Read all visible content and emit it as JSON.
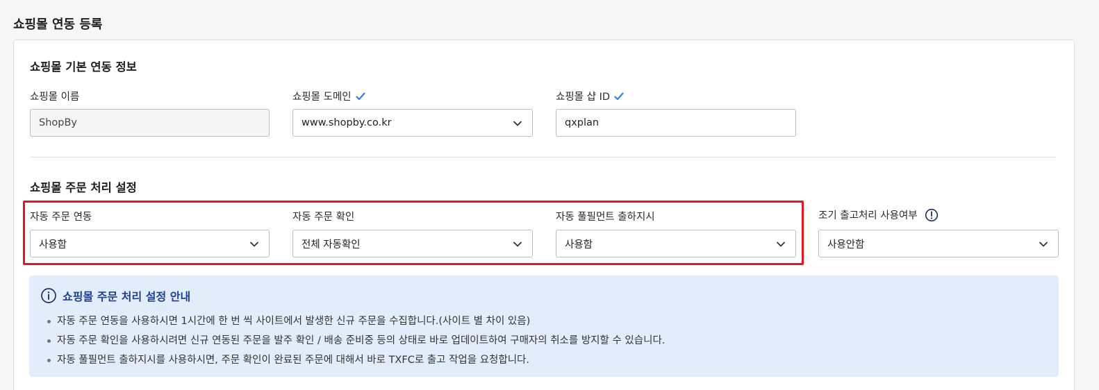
{
  "page": {
    "title": "쇼핑몰 연동 등록"
  },
  "basic": {
    "title": "쇼핑몰 기본 연동 정보",
    "name_label": "쇼핑몰 이름",
    "name_value": "ShopBy",
    "domain_label": "쇼핑몰 도메인",
    "domain_value": "www.shopby.co.kr",
    "shop_id_label": "쇼핑몰 샵 ID",
    "shop_id_value": "qxplan"
  },
  "order": {
    "title": "쇼핑몰 주문 처리 설정",
    "auto_link_label": "자동 주문 연동",
    "auto_link_value": "사용함",
    "auto_confirm_label": "자동 주문 확인",
    "auto_confirm_value": "전체 자동확인",
    "auto_fulfill_label": "자동 풀필먼트 출하지시",
    "auto_fulfill_value": "사용함",
    "early_ship_label": "조기 출고처리 사용여부",
    "early_ship_value": "사용안함"
  },
  "notice": {
    "title": "쇼핑몰 주문 처리 설정 안내",
    "items": [
      "자동 주문 연동을 사용하시면 1시간에 한 번 씩 사이트에서 발생한 신규 주문을 수집합니다.(사이트 별 차이 있음)",
      "자동 주문 확인을 사용하시려면 신규 연동된 주문을 발주 확인 / 배송 준비중 등의 상태로 바로 업데이트하여 구매자의 취소를 방지할 수 있습니다.",
      "자동 풀필먼트 출하지시를 사용하시면, 주문 확인이 완료된 주문에 대해서 바로 TXFC로 출고 작업을 요청합니다."
    ]
  },
  "icons": {
    "check": "check-icon",
    "chevron": "chevron-down-icon",
    "info": "info-icon",
    "exclamation": "exclamation-circle-icon"
  },
  "colors": {
    "accent": "#2f80ed",
    "highlight": "#e8141c",
    "notice_bg": "#e2edfc",
    "notice_title": "#1c3f8f"
  }
}
